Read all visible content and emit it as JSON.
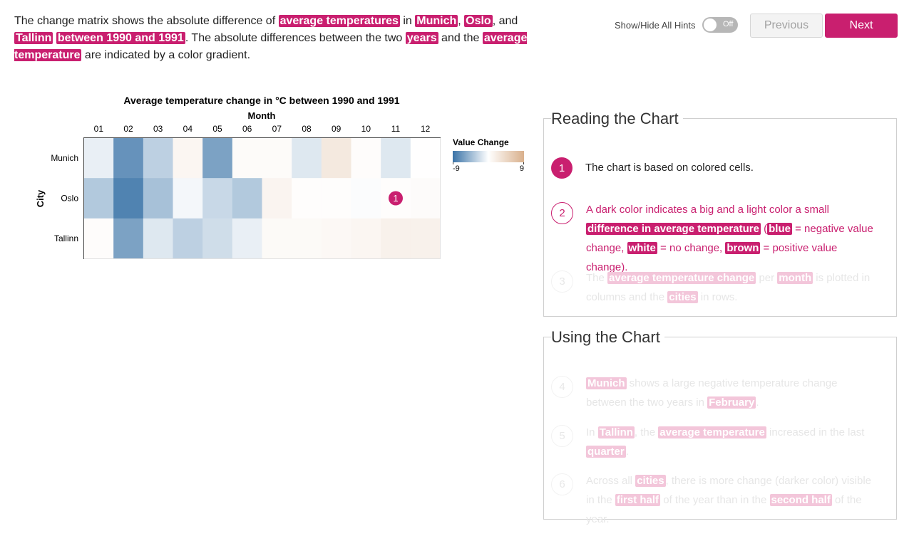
{
  "intro": {
    "t1": "The change matrix shows the absolute difference of ",
    "h1": "average temperatures",
    "t2": " in ",
    "h2": "Munich",
    "t3": ", ",
    "h3": "Oslo",
    "t4": ", and ",
    "h4": "Tallinn",
    "t5": " ",
    "h5": "between 1990 and 1991",
    "t6": ". The absolute differences between the two ",
    "h6": "years",
    "t7": " and the ",
    "h7": "average temperature",
    "t8": " are indicated by a color gradient."
  },
  "controls": {
    "hints_label": "Show/Hide All Hints",
    "toggle_state": "Off",
    "previous_label": "Previous",
    "next_label": "Next"
  },
  "chart_data": {
    "type": "heatmap",
    "title": "Average temperature change in °C between 1990 and 1991",
    "xlabel": "Month",
    "ylabel": "City",
    "x": [
      "01",
      "02",
      "03",
      "04",
      "05",
      "06",
      "07",
      "08",
      "09",
      "10",
      "11",
      "12"
    ],
    "y": [
      "Munich",
      "Oslo",
      "Tallinn"
    ],
    "values": [
      [
        -1,
        -7,
        -3,
        1,
        -6,
        0.5,
        0.5,
        -1.5,
        2.5,
        0.3,
        -1.5,
        0.1
      ],
      [
        -3.5,
        -8,
        -4,
        -0.5,
        -2.5,
        -3.5,
        1.2,
        0.2,
        0.2,
        -0.2,
        0.2,
        0.4
      ],
      [
        0.3,
        -6,
        -1.5,
        -3,
        -2.2,
        -1,
        0.6,
        0.6,
        0.8,
        1,
        1.6,
        1.6
      ]
    ],
    "legend": {
      "title": "Value Change",
      "min": -9,
      "max": 9,
      "min_label": "-9",
      "max_label": "9",
      "low_color": "#3a73a7",
      "mid_color": "#ffffff",
      "high_color": "#d9b08c"
    },
    "marker": {
      "row": "Oslo",
      "column": "11",
      "label": "1"
    }
  },
  "reading": {
    "title": "Reading the Chart",
    "s1": {
      "num": "1",
      "text": "The chart is based on colored cells."
    },
    "s2": {
      "num": "2",
      "a": "A dark color indicates a big and a light color a small ",
      "h1": "difference in average temperature",
      "b": " (",
      "h2": "blue",
      "c": " = negative value change, ",
      "h3": "white",
      "d": " = no change, ",
      "h4": "brown",
      "e": " = positive value change)."
    },
    "s3": {
      "num": "3",
      "a": "The ",
      "h1": "average temperature change",
      "b": " per ",
      "h2": "month",
      "c": " is plotted in columns and the ",
      "h3": "cities",
      "d": " in rows."
    }
  },
  "using": {
    "title": "Using the Chart",
    "s4": {
      "num": "4",
      "h1": "Munich",
      "a": " shows a large negative temperature change between the two years in ",
      "h2": "February",
      "b": "."
    },
    "s5": {
      "num": "5",
      "a": "In ",
      "h1": "Tallinn",
      "b": ", the ",
      "h2": "average temperature",
      "c": " increased in the last ",
      "h3": "quarter",
      "d": "."
    },
    "s6": {
      "num": "6",
      "a": "Across all ",
      "h1": "cities",
      "b": ", there is more change (darker color) visible in the ",
      "h2": "first half",
      "c": " of the year than in the ",
      "h3": "second half",
      "d": " of the year."
    }
  }
}
